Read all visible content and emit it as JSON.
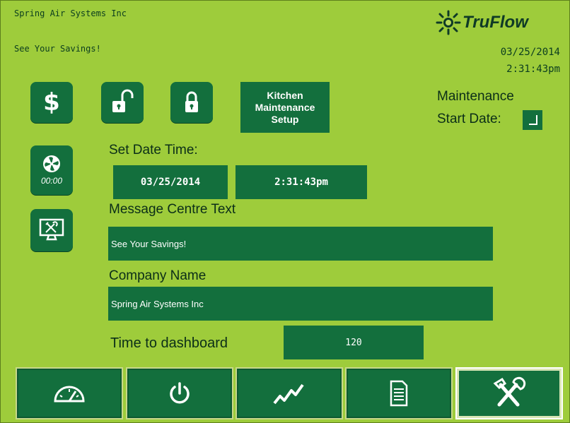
{
  "header": {
    "company_line": "Spring Air Systems Inc",
    "message_line": "See Your Savings!",
    "logo_text": "TruFlow",
    "date": "03/25/2014",
    "time": "2:31:43pm"
  },
  "side_buttons": {
    "fan_timer_label": "00:00"
  },
  "setup_button": {
    "line1": "Kitchen",
    "line2": "Maintenance",
    "line3": "Setup"
  },
  "maintenance": {
    "label_line1": "Maintenance",
    "label_line2": "Start Date:"
  },
  "form": {
    "set_date_time_label": "Set Date Time:",
    "date_value": "03/25/2014",
    "time_value": "2:31:43pm",
    "message_centre_label": "Message Centre Text",
    "message_centre_value": "See Your Savings!",
    "company_name_label": "Company Name",
    "company_name_value": "Spring Air Systems Inc",
    "time_to_dashboard_label": "Time to dashboard",
    "time_to_dashboard_value": "120"
  },
  "icons": {
    "dollar": "dollar-icon",
    "unlock": "unlock-icon",
    "lock": "lock-icon",
    "fan": "fan-icon",
    "monitor_tools": "monitor-tools-icon",
    "gauge": "gauge-icon",
    "power": "power-icon",
    "trend": "trend-icon",
    "document": "document-icon",
    "tools": "tools-icon"
  },
  "colors": {
    "background": "#9ecc3b",
    "button": "#136f3d",
    "text": "#0b2e18"
  }
}
